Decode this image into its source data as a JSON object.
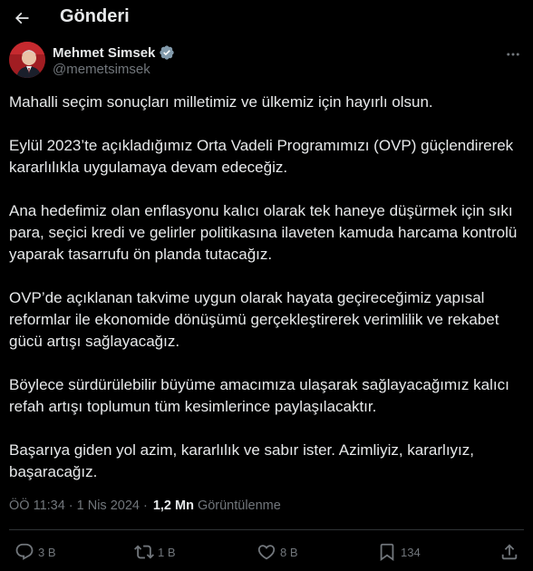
{
  "header": {
    "title": "Gönderi"
  },
  "author": {
    "name": "Mehmet Simsek",
    "handle": "@memetsimsek"
  },
  "tweet": {
    "paragraphs": [
      "Mahalli seçim sonuçları milletimiz ve ülkemiz için hayırlı olsun.",
      "Eylül 2023’te açıkladığımız Orta Vadeli Programımızı (OVP) güçlendirerek kararlılıkla uygulamaya devam edeceğiz.",
      "Ana hedefimiz olan enflasyonu kalıcı olarak tek haneye düşürmek için sıkı para, seçici kredi ve gelirler politikasına ilaveten kamuda harcama kontrolü yaparak tasarrufu ön planda tutacağız.",
      "OVP’de açıklanan takvime uygun olarak hayata geçireceğimiz yapısal reformlar ile ekonomide dönüşümü gerçekleştirerek verimlilik ve rekabet gücü artışı sağlayacağız.",
      "Böylece sürdürülebilir büyüme amacımıza ulaşarak sağlayacağımız kalıcı refah artışı toplumun tüm kesimlerince paylaşılacaktır.",
      "Başarıya giden yol azim, kararlılık ve sabır ister. Azimliyiz, kararlıyız, başaracağız."
    ]
  },
  "meta": {
    "time": "ÖÖ 11:34",
    "separator": "·",
    "date": "1 Nis 2024",
    "views_count": "1,2 Mn",
    "views_label": "Görüntülenme"
  },
  "actions": {
    "replies": "3 B",
    "reposts": "1 B",
    "likes": "8 B",
    "bookmarks": "134"
  },
  "colors": {
    "background": "#000000",
    "text": "#e7e9ea",
    "secondary": "#71767b",
    "verified": "#1d9bf0",
    "divider": "#2f3336"
  },
  "icons": {
    "back": "arrow-left-icon",
    "verified": "verified-badge-icon",
    "more": "more-horizontal-icon",
    "reply": "reply-icon",
    "repost": "repost-icon",
    "like": "heart-icon",
    "bookmark": "bookmark-icon",
    "share": "share-icon"
  }
}
